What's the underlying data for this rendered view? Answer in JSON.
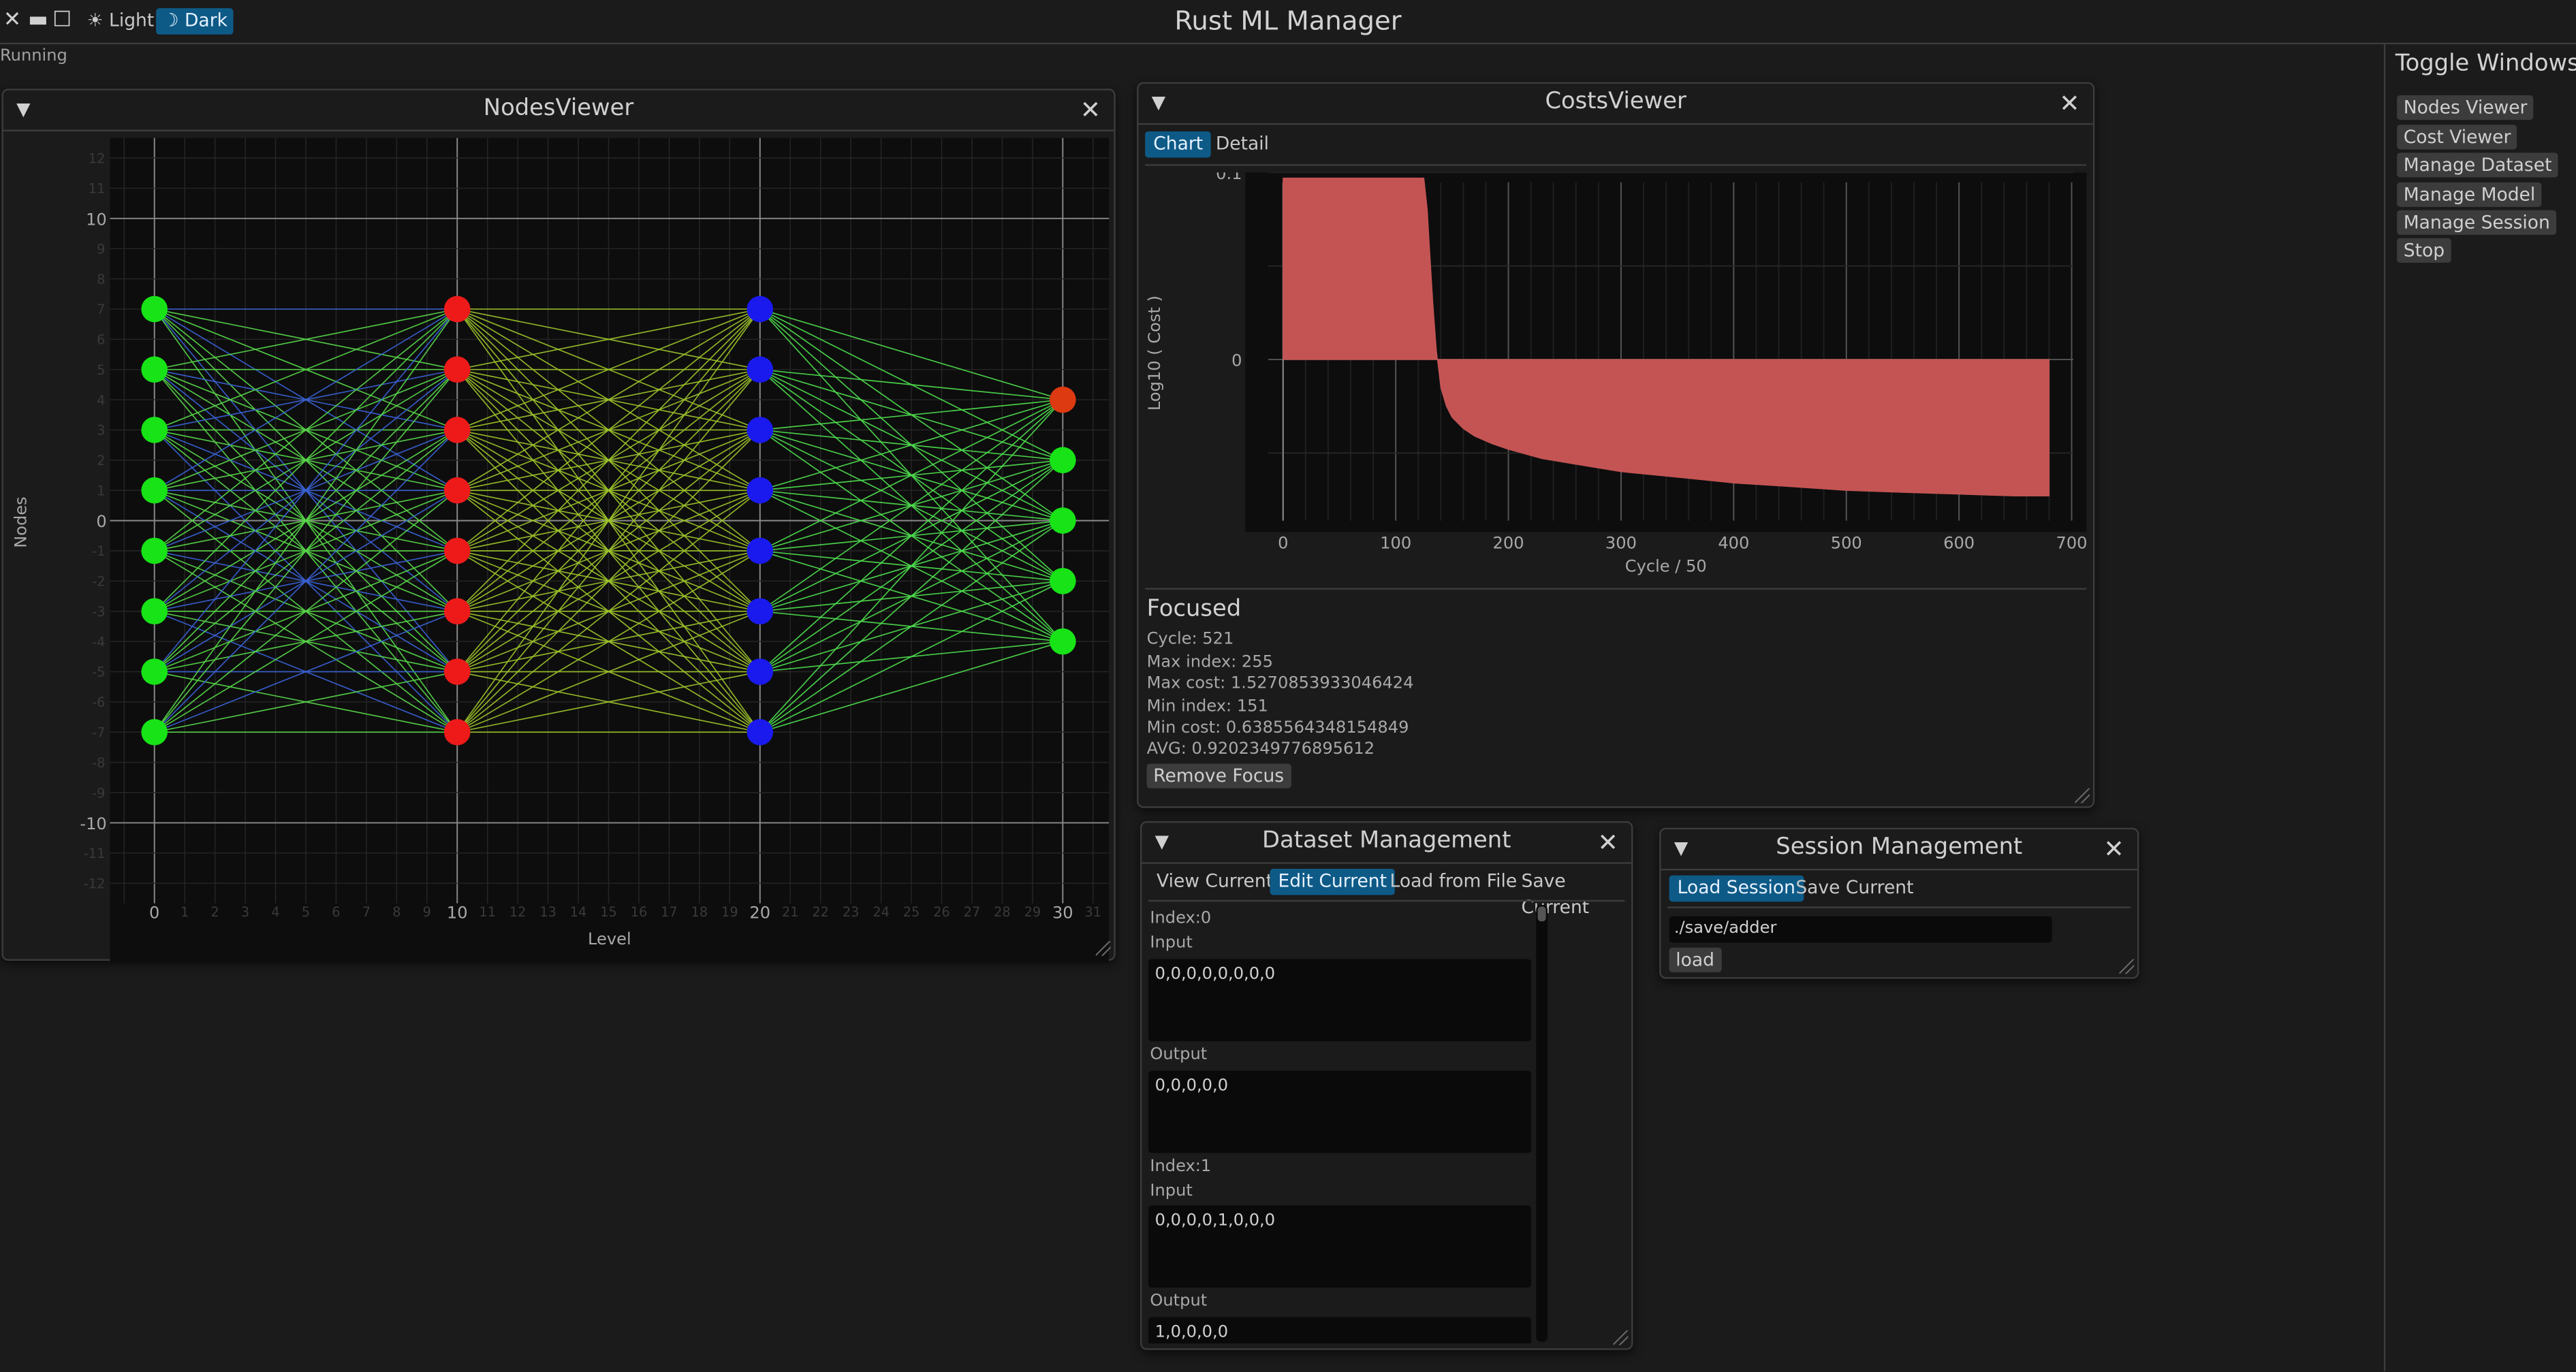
{
  "app": {
    "title": "Rust ML Manager",
    "status": "Running",
    "theme_light": "☀ Light",
    "theme_dark": "☽ Dark",
    "window_controls": {
      "close": "✕",
      "minimize": "▬",
      "maximize": "☐"
    }
  },
  "toggle_windows": {
    "title": "Toggle Windows",
    "items": [
      "Nodes Viewer",
      "Cost Viewer",
      "Manage Dataset",
      "Manage Model",
      "Manage Session",
      "Stop"
    ]
  },
  "nodes_viewer": {
    "title": "NodesViewer",
    "xlabel": "Level",
    "ylabel": "Nodes",
    "x_ticks_major": [
      "0",
      "10",
      "20",
      "30"
    ],
    "y_ticks_major": [
      "10",
      "0",
      "-10"
    ],
    "layers": [
      {
        "level": 0,
        "nodes": 8,
        "colors": [
          "#17e317",
          "#17e317",
          "#17e317",
          "#17e317",
          "#17e317",
          "#17e317",
          "#17e317",
          "#17e317"
        ]
      },
      {
        "level": 10,
        "nodes": 8,
        "colors": [
          "#ee1a1a",
          "#ee1a1a",
          "#ee1a1a",
          "#ee1a1a",
          "#ee1a1a",
          "#ee1a1a",
          "#ee1a1a",
          "#ee1a1a"
        ]
      },
      {
        "level": 20,
        "nodes": 8,
        "colors": [
          "#1a1aee",
          "#1a1aee",
          "#1a1aee",
          "#1a1aee",
          "#1a1aee",
          "#1a1aee",
          "#1a1aee",
          "#1a1aee"
        ]
      },
      {
        "level": 30,
        "nodes": 5,
        "colors": [
          "#dd3a12",
          "#17e317",
          "#17e317",
          "#17e317",
          "#17e317"
        ]
      }
    ]
  },
  "costs_viewer": {
    "title": "CostsViewer",
    "tabs": [
      "Chart",
      "Detail"
    ],
    "focused_title": "Focused",
    "details": [
      "Cycle: 521",
      "Max index: 255",
      "Max cost: 1.5270853933046424",
      "Min index: 151",
      "Min cost: 0.6385564348154849",
      "AVG: 0.9202349776895612"
    ],
    "remove_focus": "Remove Focus"
  },
  "chart_data": {
    "type": "area",
    "xlabel": "Cycle / 50",
    "ylabel": "Log10 ( Cost )",
    "xlim": [
      0,
      700
    ],
    "ylim": [
      -0.08,
      0.1
    ],
    "x_tick_labels": [
      "0",
      "100",
      "200",
      "300",
      "400",
      "500",
      "600",
      "700"
    ],
    "y_tick_labels": [
      "0.1",
      "0"
    ],
    "color": "#c45454",
    "x": [
      0,
      125,
      128,
      130,
      133,
      136,
      140,
      145,
      150,
      160,
      170,
      185,
      200,
      230,
      260,
      300,
      350,
      400,
      450,
      500,
      550,
      600,
      650,
      680
    ],
    "values": [
      0.097,
      0.097,
      0.08,
      0.06,
      0.03,
      0.005,
      -0.015,
      -0.025,
      -0.031,
      -0.037,
      -0.041,
      -0.045,
      -0.048,
      -0.053,
      -0.056,
      -0.06,
      -0.063,
      -0.066,
      -0.068,
      -0.07,
      -0.071,
      -0.072,
      -0.073,
      -0.073
    ]
  },
  "dataset_management": {
    "title": "Dataset Management",
    "tabs": [
      "View Current",
      "Edit Current",
      "Load from File",
      "Save Current"
    ],
    "entries": [
      {
        "index_label": "Index:0",
        "input_label": "Input",
        "input": "0,0,0,0,0,0,0,0",
        "output_label": "Output",
        "output": "0,0,0,0,0"
      },
      {
        "index_label": "Index:1",
        "input_label": "Input",
        "input": "0,0,0,0,1,0,0,0",
        "output_label": "Output",
        "output": "1,0,0,0,0"
      }
    ]
  },
  "session_management": {
    "title": "Session Management",
    "tabs": [
      "Load Session",
      "Save Current"
    ],
    "path": "./save/adder",
    "load_button": "load"
  }
}
